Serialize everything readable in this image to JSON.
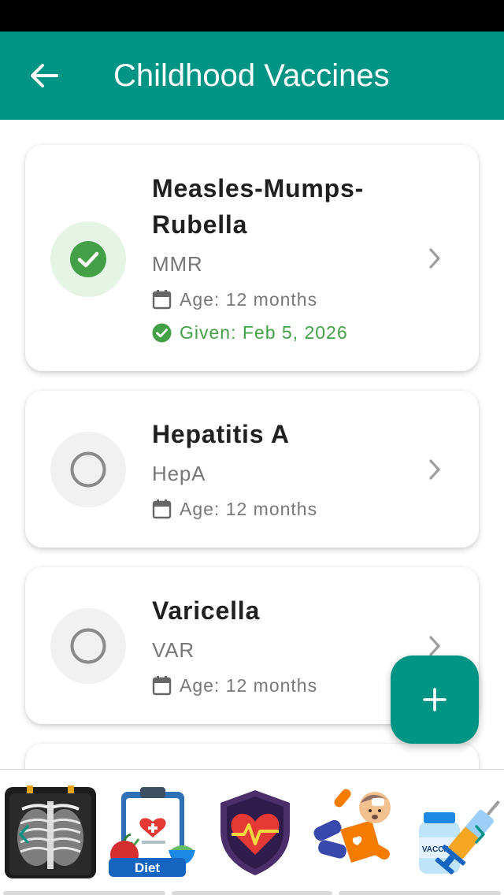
{
  "app_bar": {
    "title": "Childhood Vaccines",
    "background": "#009485",
    "back_icon": "arrow-left-icon"
  },
  "vaccines": [
    {
      "name": "Measles-Mumps-Rubella",
      "abbreviation": "MMR",
      "age": "Age: 12 months",
      "status": "given",
      "given": "Given: Feb 5, 2026"
    },
    {
      "name": "Hepatitis A",
      "abbreviation": "HepA",
      "age": "Age: 12 months",
      "status": "pending"
    },
    {
      "name": "Varicella",
      "abbreviation": "VAR",
      "age": "Age: 12 months",
      "status": "pending"
    }
  ],
  "fab": {
    "icon": "plus-icon"
  },
  "bottom_strip": {
    "items": [
      {
        "icon": "chest-xray-icon"
      },
      {
        "icon": "diet-clipboard-icon",
        "label": "Diet"
      },
      {
        "icon": "heart-shield-icon"
      },
      {
        "icon": "falling-person-icon"
      },
      {
        "icon": "vaccine-vial-syringe-icon",
        "label": "VACCINE"
      }
    ]
  },
  "colors": {
    "primary": "#009485",
    "given_green": "#43a047",
    "muted_text": "#777777"
  }
}
